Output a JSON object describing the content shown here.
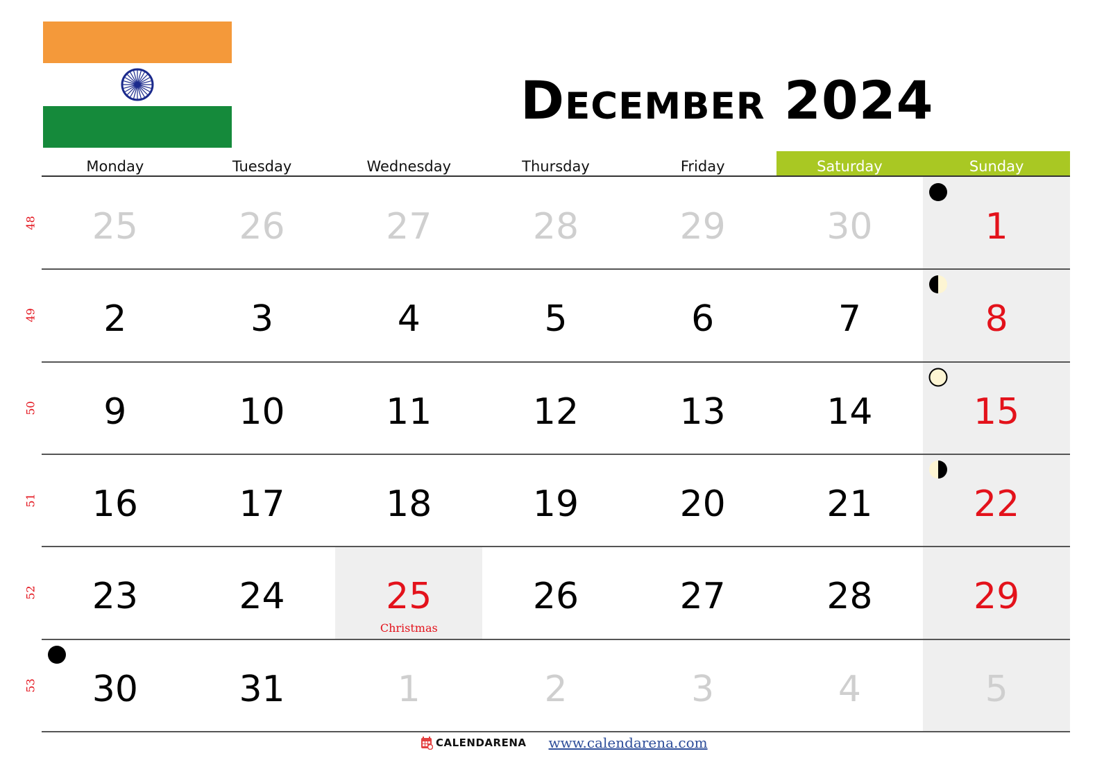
{
  "header": {
    "month": "December",
    "year": "2024",
    "flag": {
      "country": "India",
      "colors": {
        "saffron": "#F4993A",
        "white": "#FFFFFF",
        "green": "#158A3B",
        "chakra": "#1B2A8C"
      }
    }
  },
  "colors": {
    "weekend_header": "#A9C823",
    "holiday_red": "#E3121B",
    "muted_day": "#CFCFCF",
    "sunday_bg": "#EFEFEF"
  },
  "weekdays": [
    "Monday",
    "Tuesday",
    "Wednesday",
    "Thursday",
    "Friday",
    "Saturday",
    "Sunday"
  ],
  "weeks": [
    {
      "week_number": "48",
      "days": [
        {
          "day": "25",
          "other": true
        },
        {
          "day": "26",
          "other": true
        },
        {
          "day": "27",
          "other": true
        },
        {
          "day": "28",
          "other": true
        },
        {
          "day": "29",
          "other": true
        },
        {
          "day": "30",
          "other": true
        },
        {
          "day": "1",
          "moon": "new-moon-icon"
        }
      ]
    },
    {
      "week_number": "49",
      "days": [
        {
          "day": "2"
        },
        {
          "day": "3"
        },
        {
          "day": "4"
        },
        {
          "day": "5"
        },
        {
          "day": "6"
        },
        {
          "day": "7"
        },
        {
          "day": "8",
          "moon": "first-quarter-moon-icon"
        }
      ]
    },
    {
      "week_number": "50",
      "days": [
        {
          "day": "9"
        },
        {
          "day": "10"
        },
        {
          "day": "11"
        },
        {
          "day": "12"
        },
        {
          "day": "13"
        },
        {
          "day": "14"
        },
        {
          "day": "15",
          "moon": "full-moon-icon"
        }
      ]
    },
    {
      "week_number": "51",
      "days": [
        {
          "day": "16"
        },
        {
          "day": "17"
        },
        {
          "day": "18"
        },
        {
          "day": "19"
        },
        {
          "day": "20"
        },
        {
          "day": "21"
        },
        {
          "day": "22",
          "moon": "last-quarter-moon-icon"
        }
      ]
    },
    {
      "week_number": "52",
      "days": [
        {
          "day": "23"
        },
        {
          "day": "24"
        },
        {
          "day": "25",
          "holiday": "Christmas"
        },
        {
          "day": "26"
        },
        {
          "day": "27"
        },
        {
          "day": "28"
        },
        {
          "day": "29"
        }
      ]
    },
    {
      "week_number": "53",
      "days": [
        {
          "day": "30",
          "moon": "new-moon-icon"
        },
        {
          "day": "31"
        },
        {
          "day": "1",
          "other": true
        },
        {
          "day": "2",
          "other": true
        },
        {
          "day": "3",
          "other": true
        },
        {
          "day": "4",
          "other": true
        },
        {
          "day": "5",
          "other": true
        }
      ]
    }
  ],
  "footer": {
    "brand": "CALENDARENA",
    "website": "www.calendarena.com"
  }
}
